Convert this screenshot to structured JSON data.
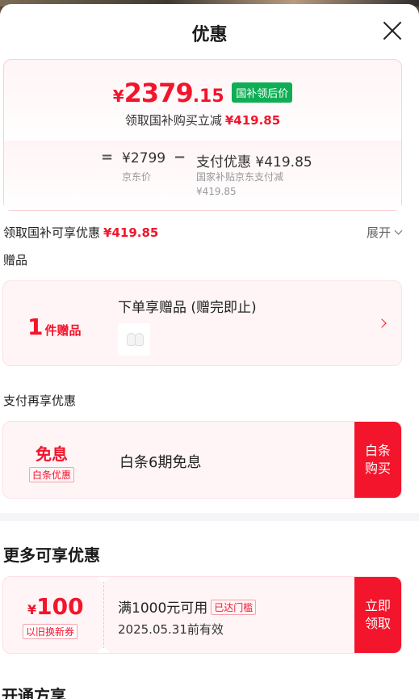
{
  "header": {
    "title": "优惠"
  },
  "price": {
    "currency": "¥",
    "integer": "2379",
    "decimal": ".15",
    "tag": "国补领后价",
    "sub_text": "领取国补购买立减",
    "sub_amount": "¥419.85",
    "equals": "=",
    "jd_price": "¥2799",
    "jd_label": "京东价",
    "minus": "−",
    "pay_title": "支付优惠 ¥419.85",
    "pay_desc": "国家补贴京东支付减 ¥419.85"
  },
  "subsidy": {
    "label": "领取国补可享优惠",
    "amount": "¥419.85",
    "expand": "展开"
  },
  "gift": {
    "section_title": "赠品",
    "count": "1",
    "count_unit": "件赠品",
    "title": "下单享赠品 (赠完即止)"
  },
  "pay": {
    "section_title": "支付再享优惠",
    "badge_big": "免息",
    "badge_label": "白条优惠",
    "text": "白条6期免息",
    "button": "白条购买"
  },
  "more": {
    "title": "更多可享优惠",
    "coupon": {
      "currency": "¥",
      "value": "100",
      "type": "以旧换新券",
      "condition": "满1000元可用",
      "status": "已达门槛",
      "validity": "2025.05.31前有效",
      "button": "立即领取"
    }
  },
  "next_section": "开通方享",
  "colors": {
    "accent": "#f2152c",
    "green_tag": "#0fae55"
  }
}
